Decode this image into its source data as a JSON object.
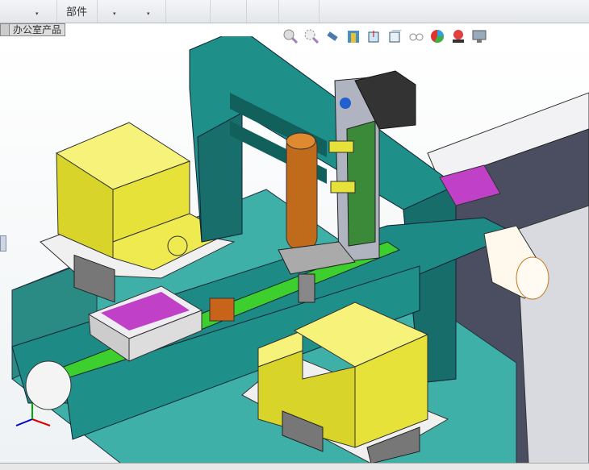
{
  "ribbon": {
    "group_label": "部件",
    "dropdown_arrow": "▾"
  },
  "tabs": [
    {
      "label": "办公室产品"
    }
  ],
  "view_toolbar": [
    {
      "icon": "zoom-to-fit-icon"
    },
    {
      "icon": "zoom-to-area-icon"
    },
    {
      "icon": "previous-view-icon"
    },
    {
      "icon": "section-view-icon"
    },
    {
      "icon": "view-orientation-icon"
    },
    {
      "icon": "display-style-icon"
    },
    {
      "icon": "hide-show-items-icon"
    },
    {
      "icon": "edit-appearance-icon"
    },
    {
      "icon": "apply-scene-icon"
    },
    {
      "icon": "view-settings-icon"
    }
  ],
  "colors": {
    "teal": "#1f8f8a",
    "yellow": "#e6e23a",
    "magenta": "#c040c8",
    "gray": "#8a8f9c",
    "belt": "#3ccf2e",
    "orange": "#c8641a"
  }
}
